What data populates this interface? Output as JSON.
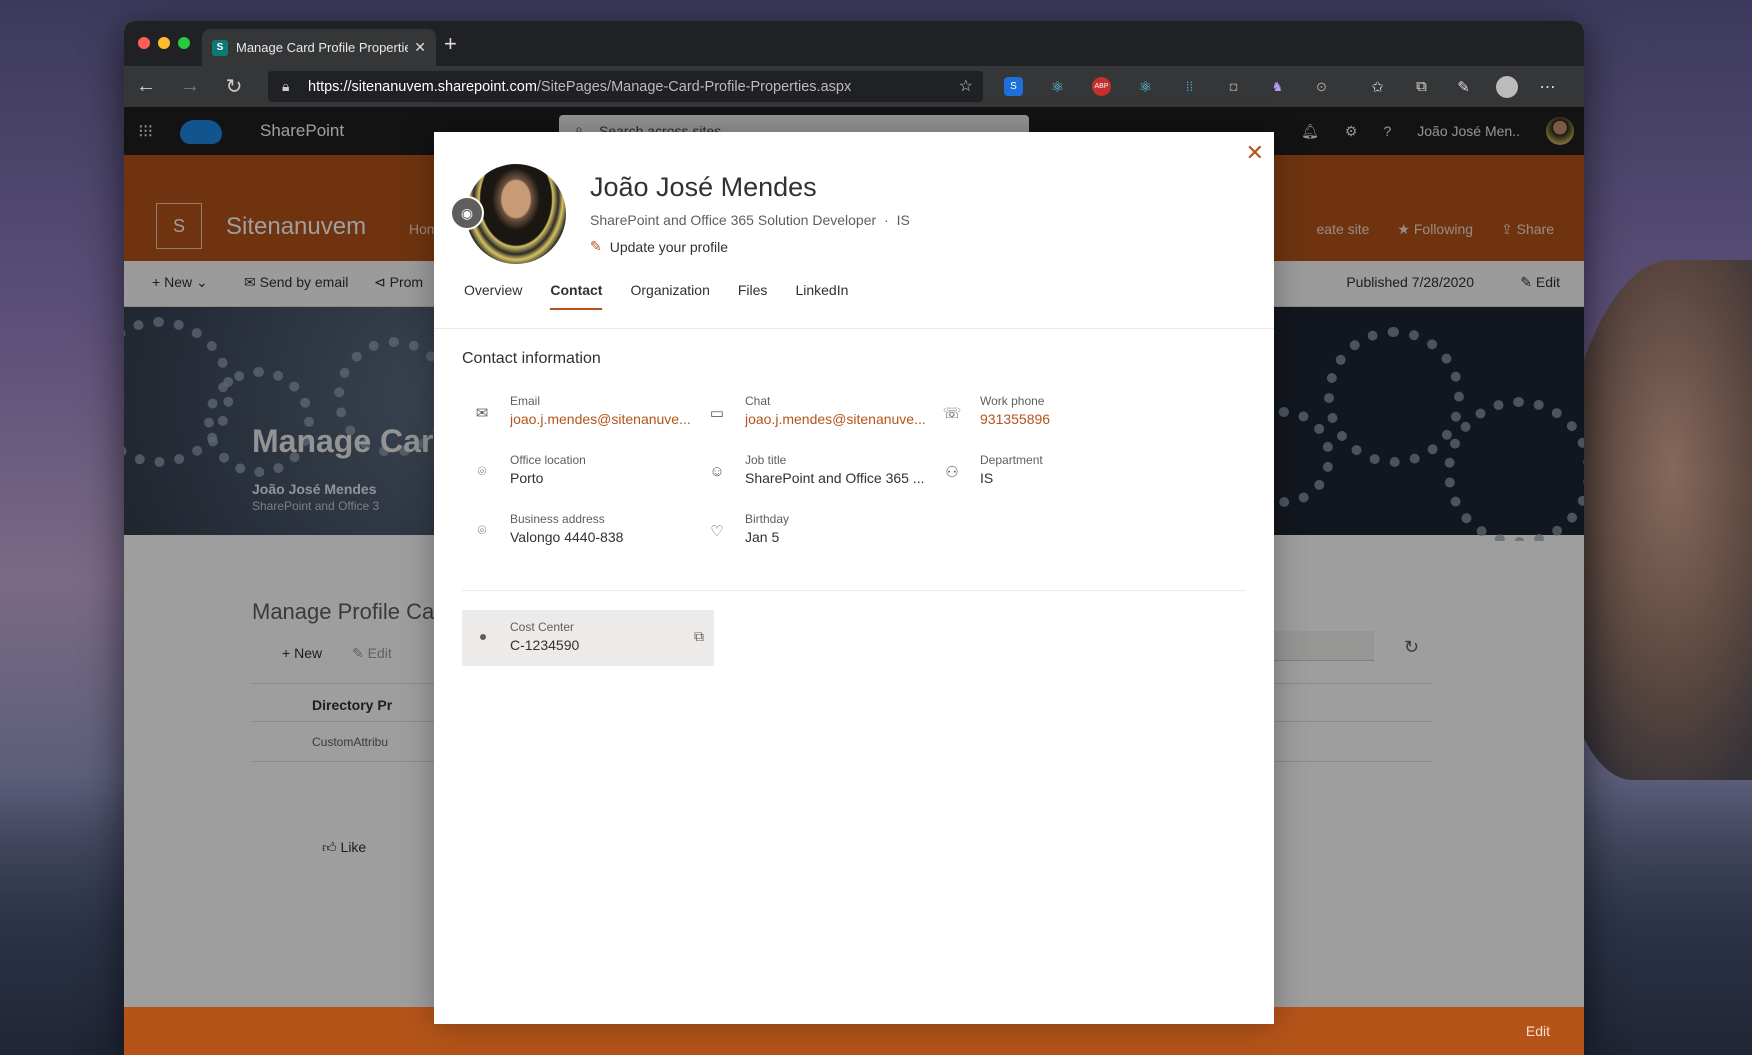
{
  "browser": {
    "tab_title": "Manage Card Profile Properties",
    "url_host": "https://sitenanuvem.sharepoint.com",
    "url_path": "/SitePages/Manage-Card-Profile-Properties.aspx"
  },
  "suite": {
    "app_name": "SharePoint",
    "search_placeholder": "Search across sites",
    "user_name": "João José Men.."
  },
  "site": {
    "logo_letter": "S",
    "name": "Sitenanuvem",
    "nav_home": "Hom",
    "actions": {
      "create": "eate site",
      "following": "Following",
      "share": "Share"
    }
  },
  "command_bar": {
    "new": "New",
    "send_by_email": "Send by email",
    "promote": "Prom",
    "published": "Published 7/28/2020",
    "edit": "Edit"
  },
  "hero": {
    "title": "Manage Carc",
    "author": "João José Mendes",
    "author_role": "SharePoint and Office 3"
  },
  "page_body": {
    "list_title": "Manage Profile Car",
    "new": "New",
    "edit": "Edit",
    "row1": "Directory Pr",
    "row2": "CustomAttribu",
    "like": "Like",
    "footer_edit": "Edit"
  },
  "profile": {
    "name": "João José Mendes",
    "title": "SharePoint and Office 365 Solution Developer",
    "department_short": "IS",
    "update": "Update your profile",
    "tabs": [
      "Overview",
      "Contact",
      "Organization",
      "Files",
      "LinkedIn"
    ],
    "active_tab": "Contact",
    "section": "Contact information",
    "fields": {
      "email": {
        "label": "Email",
        "value": "joao.j.mendes@sitenanuve..."
      },
      "chat": {
        "label": "Chat",
        "value": "joao.j.mendes@sitenanuve..."
      },
      "work_phone": {
        "label": "Work phone",
        "value": "931355896"
      },
      "office": {
        "label": "Office location",
        "value": "Porto"
      },
      "job": {
        "label": "Job title",
        "value": "SharePoint and Office 365 ..."
      },
      "department": {
        "label": "Department",
        "value": "IS"
      },
      "address": {
        "label": "Business address",
        "value": "Valongo 4440-838"
      },
      "birthday": {
        "label": "Birthday",
        "value": "Jan 5"
      }
    },
    "cost_center": {
      "label": "Cost Center",
      "value": "C-1234590"
    }
  },
  "colors": {
    "accent": "#b45419",
    "suite_bar": "#202020"
  }
}
